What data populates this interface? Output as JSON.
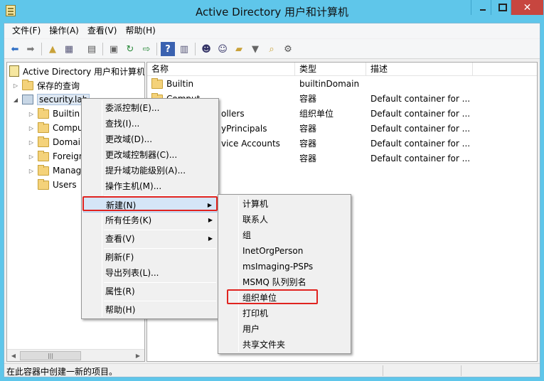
{
  "window": {
    "title": "Active Directory 用户和计算机"
  },
  "menubar": [
    "文件(F)",
    "操作(A)",
    "查看(V)",
    "帮助(H)"
  ],
  "tree": {
    "root": "Active Directory 用户和计算机",
    "saved_queries": "保存的查询",
    "domain": "security.lab",
    "children": [
      "Builtin",
      "Compu",
      "Domain",
      "Foreign",
      "Manag",
      "Users"
    ]
  },
  "list": {
    "columns": [
      "名称",
      "类型",
      "描述"
    ],
    "rows": [
      {
        "name": "Builtin",
        "type": "builtinDomain",
        "desc": ""
      },
      {
        "name": "Comput",
        "type": "容器",
        "desc": "Default container for ..."
      },
      {
        "name": "ollers",
        "type": "组织单位",
        "desc": "Default container for ..."
      },
      {
        "name": "yPrincipals",
        "type": "容器",
        "desc": "Default container for ..."
      },
      {
        "name": "vice Accounts",
        "type": "容器",
        "desc": "Default container for ..."
      },
      {
        "name": "",
        "type": "容器",
        "desc": "Default container for ..."
      }
    ]
  },
  "context_menu": {
    "items": [
      "委派控制(E)...",
      "查找(I)...",
      "更改域(D)...",
      "更改域控制器(C)...",
      "提升域功能级别(A)...",
      "操作主机(M)...",
      "新建(N)",
      "所有任务(K)",
      "查看(V)",
      "刷新(F)",
      "导出列表(L)...",
      "属性(R)",
      "帮助(H)"
    ]
  },
  "submenu": {
    "items": [
      "计算机",
      "联系人",
      "组",
      "InetOrgPerson",
      "msImaging-PSPs",
      "MSMQ 队列别名",
      "组织单位",
      "打印机",
      "用户",
      "共享文件夹"
    ]
  },
  "status": {
    "text": "在此容器中创建一新的项目。"
  },
  "colors": {
    "highlight_box": "#e0231f",
    "title_bar": "#5fc6ea"
  }
}
